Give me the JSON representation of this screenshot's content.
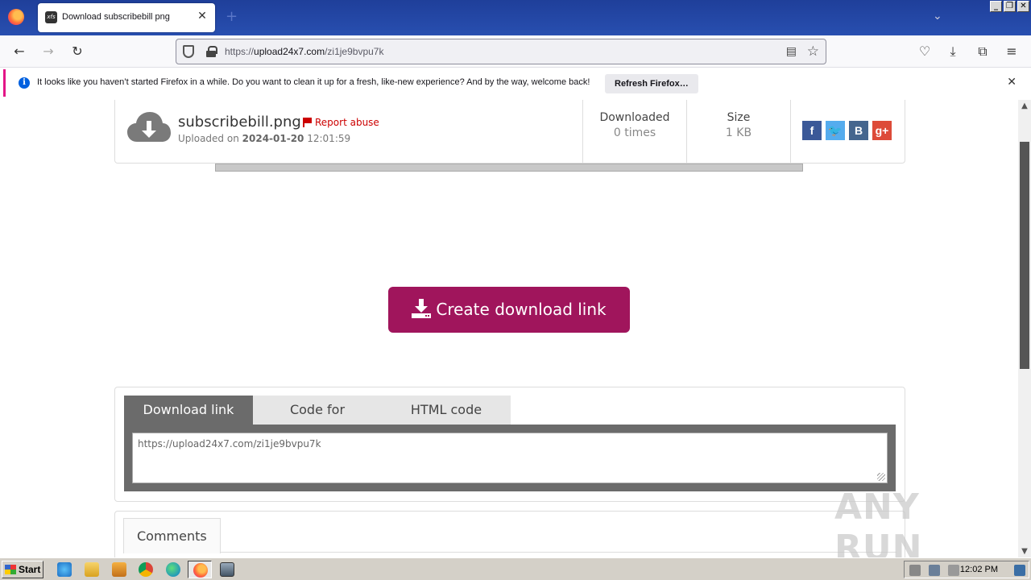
{
  "browser": {
    "tab_title": "Download subscribebill png",
    "tab_favicon_text": "xfs",
    "url_prefix": "https://",
    "url_host": "upload24x7.com",
    "url_path": "/zi1je9bvpu7k",
    "new_tab_symbol": "+",
    "close_symbol": "✕"
  },
  "notification": {
    "text": "It looks like you haven’t started Firefox in a while. Do you want to clean it up for a fresh, like-new experience? And by the way, welcome back!",
    "button": "Refresh Firefox…"
  },
  "file": {
    "name": "subscribebill.png",
    "report_label": "Report abuse",
    "uploaded_prefix": "Uploaded on",
    "uploaded_date": "2024-01-20",
    "uploaded_time": "12:01:59",
    "downloaded_label": "Downloaded",
    "downloaded_value": "0 times",
    "size_label": "Size",
    "size_value": "1 KB"
  },
  "socials": [
    {
      "label": "f",
      "icon": "facebook-icon",
      "color": "#3b5998"
    },
    {
      "label": "🐦",
      "icon": "twitter-icon",
      "color": "#55acee"
    },
    {
      "label": "B",
      "icon": "vk-icon",
      "color": "#45668e"
    },
    {
      "label": "g+",
      "icon": "google-plus-icon",
      "color": "#dd4b39"
    }
  ],
  "create_button": "Create download link",
  "link_tabs": [
    "Download link",
    "Code for forums",
    "HTML code"
  ],
  "link_value": "https://upload24x7.com/zi1je9bvpu7k",
  "comments_tab": "Comments",
  "watermark": "ANY RUN",
  "taskbar": {
    "start_label": "Start",
    "clock": "12:02 PM"
  },
  "colors": {
    "accent": "#a0155c",
    "firefox_titlebar": "#284fb0",
    "notif_stripe": "#e31587"
  }
}
